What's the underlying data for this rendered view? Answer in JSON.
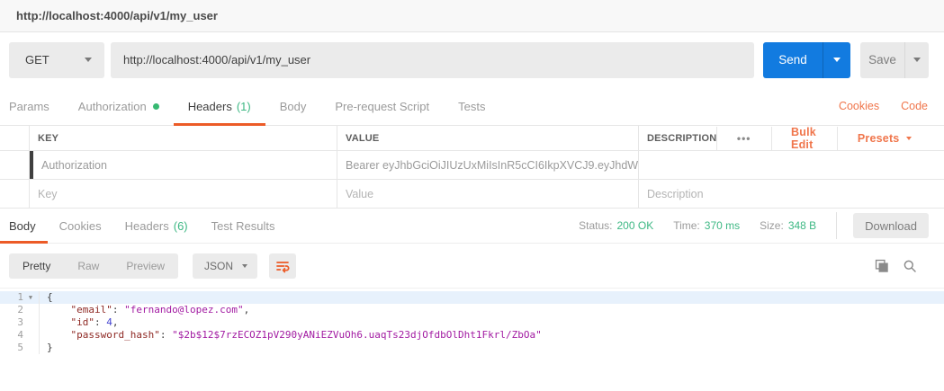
{
  "titlebar": {
    "title": "http://localhost:4000/api/v1/my_user"
  },
  "request_bar": {
    "method": "GET",
    "url": "http://localhost:4000/api/v1/my_user",
    "send_label": "Send",
    "save_label": "Save"
  },
  "request_tabs": {
    "params": "Params",
    "authorization": "Authorization",
    "headers": "Headers",
    "headers_count": "(1)",
    "body": "Body",
    "pre_request": "Pre-request Script",
    "tests": "Tests",
    "cookies_link": "Cookies",
    "code_link": "Code"
  },
  "headers_table": {
    "col_key": "KEY",
    "col_value": "VALUE",
    "col_description": "DESCRIPTION",
    "more_menu": "•••",
    "bulk_edit": "Bulk Edit",
    "presets": "Presets",
    "rows": [
      {
        "key": "Authorization",
        "value": "Bearer eyJhbGciOiJIUzUxMiIsInR5cCI6IkpXVCJ9.eyJhdW...",
        "description": ""
      }
    ],
    "new_row_placeholders": {
      "key": "Key",
      "value": "Value",
      "description": "Description"
    }
  },
  "response": {
    "tabs": {
      "body": "Body",
      "cookies": "Cookies",
      "headers": "Headers",
      "headers_count": "(6)",
      "test_results": "Test Results"
    },
    "meta": {
      "status_label": "Status:",
      "status_value": "200 OK",
      "time_label": "Time:",
      "time_value": "370 ms",
      "size_label": "Size:",
      "size_value": "348 B",
      "download_label": "Download"
    },
    "toolbar": {
      "pretty": "Pretty",
      "raw": "Raw",
      "preview": "Preview",
      "format": "JSON"
    }
  },
  "response_body": {
    "highlight_line": 0,
    "lines": [
      {
        "number": "1",
        "fold": true,
        "tokens": [
          {
            "t": "punc",
            "v": "{"
          }
        ]
      },
      {
        "number": "2",
        "fold": false,
        "tokens": [
          {
            "t": "punc",
            "v": "    "
          },
          {
            "t": "key",
            "v": "\"email\""
          },
          {
            "t": "punc",
            "v": ": "
          },
          {
            "t": "str",
            "v": "\"fernando@lopez.com\""
          },
          {
            "t": "punc",
            "v": ","
          }
        ]
      },
      {
        "number": "3",
        "fold": false,
        "tokens": [
          {
            "t": "punc",
            "v": "    "
          },
          {
            "t": "key",
            "v": "\"id\""
          },
          {
            "t": "punc",
            "v": ": "
          },
          {
            "t": "num",
            "v": "4"
          },
          {
            "t": "punc",
            "v": ","
          }
        ]
      },
      {
        "number": "4",
        "fold": false,
        "tokens": [
          {
            "t": "punc",
            "v": "    "
          },
          {
            "t": "key",
            "v": "\"password_hash\""
          },
          {
            "t": "punc",
            "v": ": "
          },
          {
            "t": "str",
            "v": "\"$2b$12$7rzECOZ1pV290yANiEZVuOh6.uaqTs23djOfdbOlDht1Fkrl/ZbOa\""
          }
        ]
      },
      {
        "number": "5",
        "fold": false,
        "tokens": [
          {
            "t": "punc",
            "v": "}"
          }
        ]
      }
    ]
  },
  "colors": {
    "accent_orange": "#ec5b27",
    "link_orange": "#f0764c",
    "green": "#3eb884",
    "send_blue": "#127be0",
    "json_key": "#8f2a25",
    "json_string": "#a21ba2",
    "json_number": "#4545d0"
  }
}
